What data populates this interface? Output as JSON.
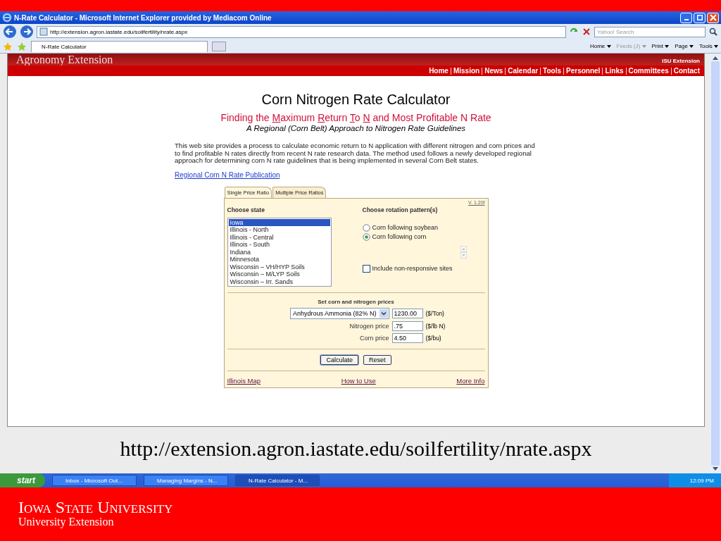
{
  "window": {
    "title": "N-Rate Calculator - Microsoft Internet Explorer provided by Mediacom Online"
  },
  "address_bar": {
    "url": "http://extension.agron.iastate.edu/soilfertility/nrate.aspx",
    "search_placeholder": "Yahoo! Search"
  },
  "browser_tab": {
    "label": "N-Rate Calculator"
  },
  "command_bar": [
    {
      "label": "Home",
      "disabled": false
    },
    {
      "label": "Feeds (J)",
      "disabled": true
    },
    {
      "label": "Print",
      "disabled": false
    },
    {
      "label": "Page",
      "disabled": false
    },
    {
      "label": "Tools",
      "disabled": false
    }
  ],
  "banner": {
    "title": "Agronomy Extension",
    "subtitle": "ISU Extension"
  },
  "nav": [
    "Home",
    "Mission",
    "News",
    "Calendar",
    "Tools",
    "Personnel",
    "Links",
    "Committees",
    "Contact"
  ],
  "page": {
    "title": "Corn Nitrogen Rate Calculator",
    "subtitle": [
      {
        "text": "Finding the ",
        "underline": false
      },
      {
        "text": "M",
        "underline": true
      },
      {
        "text": "aximum ",
        "underline": false
      },
      {
        "text": "R",
        "underline": true
      },
      {
        "text": "eturn ",
        "underline": false
      },
      {
        "text": "T",
        "underline": true
      },
      {
        "text": "o ",
        "underline": false
      },
      {
        "text": "N",
        "underline": true
      },
      {
        "text": " and Most Profitable N Rate",
        "underline": false
      }
    ],
    "tagline": "A Regional (Corn Belt) Approach to Nitrogen Rate Guidelines",
    "intro": "This web site provides a process to calculate economic return to N application with different nitrogen and corn prices and to find profitable N rates directly from recent N rate research data. The method used follows a newly developed regional approach for determining corn N rate guidelines that is being implemented in several Corn Belt states.",
    "publication_link": "Regional Corn N Rate Publication"
  },
  "calculator": {
    "tabs": [
      {
        "label": "Single Price Ratio",
        "selected": true
      },
      {
        "label": "Multiple Price Ratios",
        "selected": false
      }
    ],
    "version": "V. 1.20f",
    "state_label": "Choose state",
    "states": [
      {
        "label": "Iowa",
        "selected": true
      },
      {
        "label": "Illinois - North",
        "selected": false
      },
      {
        "label": "Illinois - Central",
        "selected": false
      },
      {
        "label": "Illinois - South",
        "selected": false
      },
      {
        "label": "Indiana",
        "selected": false
      },
      {
        "label": "Minnesota",
        "selected": false
      },
      {
        "label": "Wisconsin – VH/HYP Soils",
        "selected": false
      },
      {
        "label": "Wisconsin – M/LYP Soils",
        "selected": false
      },
      {
        "label": "Wisconsin – Irr. Sands",
        "selected": false
      }
    ],
    "rotation_label": "Choose rotation pattern(s)",
    "rotations": [
      {
        "label": "Corn following soybean",
        "selected": false
      },
      {
        "label": "Corn following corn",
        "selected": true
      }
    ],
    "nonresponsive": {
      "label": "Include non-responsive sites",
      "checked": false
    },
    "prices_heading": "Set corn and nitrogen prices",
    "fertilizer": {
      "value": "Anhydrous Ammonia (82% N)",
      "price": "1230.00",
      "unit": "($/Ton)"
    },
    "nitrogen": {
      "label": "Nitrogen price",
      "value": ".75",
      "unit": "($/lb N)"
    },
    "corn": {
      "label": "Corn price",
      "value": "4.50",
      "unit": "($/bu)"
    },
    "buttons": [
      "Calculate",
      "Reset"
    ],
    "links": [
      "Illinois Map",
      "How to Use",
      "More Info"
    ]
  },
  "caption": "http://extension.agron.iastate.edu/soilfertility/nrate.aspx",
  "taskbar": {
    "start": "start",
    "items": [
      {
        "label": "Inbox - Microsoft Out...",
        "selected": false
      },
      {
        "label": "Managing Margins - N...",
        "selected": false
      },
      {
        "label": "N-Rate Calculator - M...",
        "selected": true
      }
    ],
    "clock": "12:09 PM"
  },
  "footer": {
    "university": "Iowa State University",
    "unit": "University Extension"
  }
}
